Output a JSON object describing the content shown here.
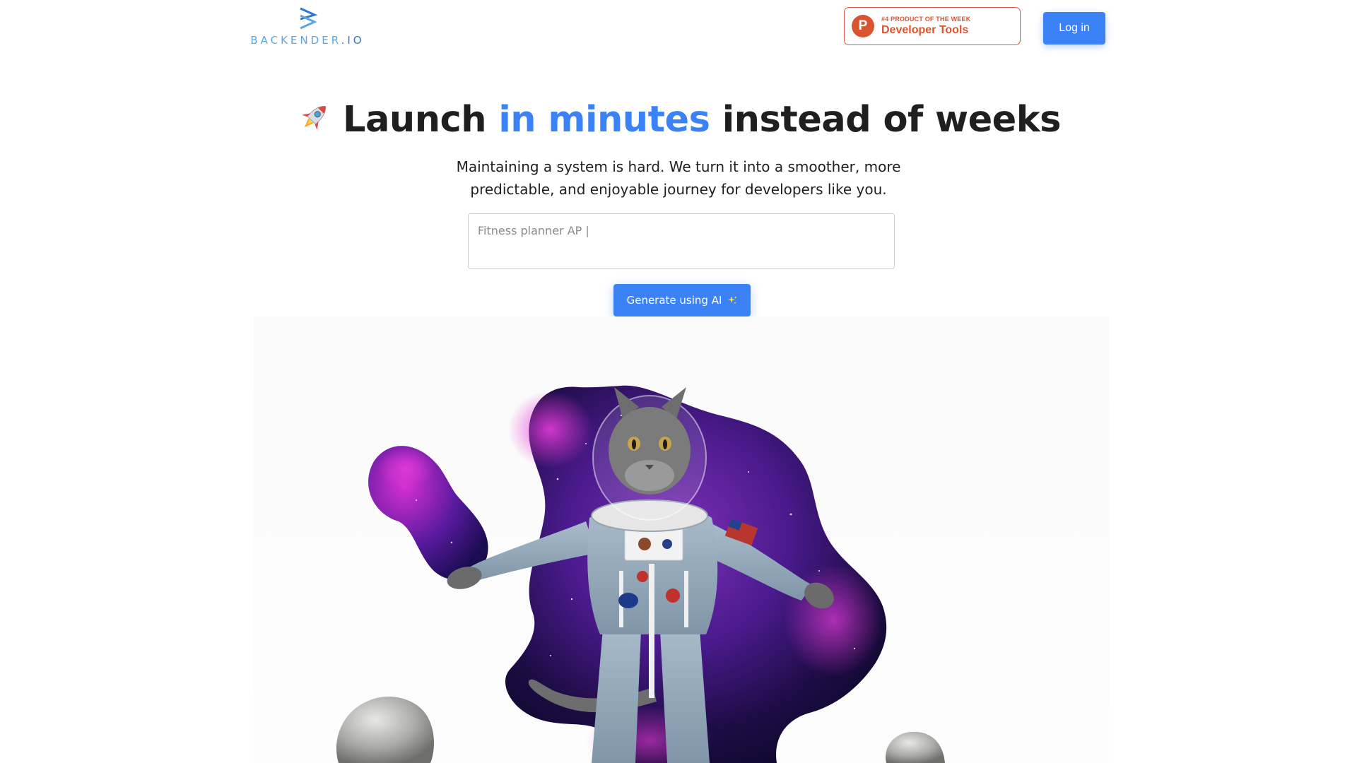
{
  "header": {
    "logo": {
      "text": "BACKENDER",
      "suffix": ".IO"
    },
    "product_hunt": {
      "rank_text": "#4 PRODUCT OF THE WEEK",
      "category": "Developer Tools",
      "icon_letter": "P"
    },
    "login_label": "Log in"
  },
  "hero": {
    "title_before": "Launch",
    "title_accent": "in minutes",
    "title_after": "instead of weeks",
    "subtitle_line1": "Maintaining a system is hard. We turn it into a smoother, more",
    "subtitle_line2": "predictable, and enjoyable journey for developers like you.",
    "prompt_value": "Fitness planner AP |",
    "generate_label": "Generate using AI"
  },
  "colors": {
    "accent": "#3b82f6",
    "product_hunt": "#da552f",
    "logo": "#5aa6e0"
  },
  "icons": {
    "logo": "chevron-arrows-icon",
    "rocket": "rocket-icon",
    "sparkle": "sparkle-icon"
  }
}
